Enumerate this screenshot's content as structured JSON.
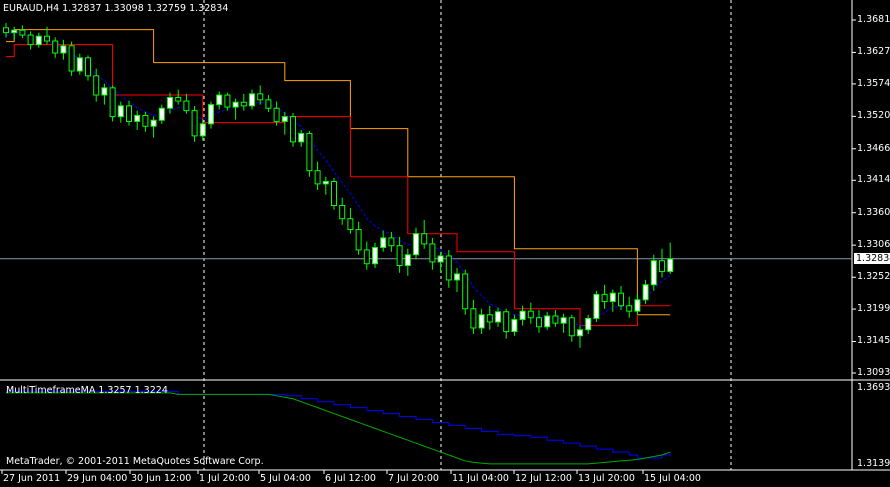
{
  "main_panel": {
    "header": "EURAUD,H4  1.32837 1.33098 1.32759 1.32834",
    "price_levels": [
      "1.36810",
      "1.36270",
      "1.35745",
      "1.35205",
      "1.34665",
      "1.34140",
      "1.33600",
      "1.33060",
      "1.32525",
      "1.31995",
      "1.31455",
      "1.30930"
    ],
    "current_price": "1.32834"
  },
  "indicator_panel": {
    "header": "MultiTimeframeMA 1.3257 1.3224",
    "levels": [
      "1.3693",
      "1.3139"
    ],
    "copyright": "MetaTrader, © 2001-2011 MetaQuotes Software Corp."
  },
  "time_axis": [
    "27 Jun 2011",
    "29 Jun 04:00",
    "30 Jun 12:00",
    "1 Jul 20:00",
    "5 Jul 04:00",
    "6 Jul 12:00",
    "7 Jul 20:00",
    "11 Jul 04:00",
    "12 Jul 12:00",
    "13 Jul 20:00",
    "15 Jul 04:00"
  ],
  "colors": {
    "background": "#000000",
    "bull_candle": "#ffffff",
    "bear_candle": "#000000",
    "wick": "#00ff00",
    "ma_fast": "#ff0000",
    "ma_slow": "#ffa500",
    "ma_dashed": "#0000ff",
    "ind_line_1": "#0000ff",
    "ind_line_2": "#00aa00"
  },
  "chart_data": {
    "type": "candlestick",
    "symbol": "EURAUD",
    "timeframe": "H4",
    "ylim": [
      1.3093,
      1.3681
    ],
    "ohlc": [
      [
        1.3668,
        1.3676,
        1.3652,
        1.366
      ],
      [
        1.366,
        1.367,
        1.3648,
        1.3664
      ],
      [
        1.3664,
        1.3672,
        1.3651,
        1.3656
      ],
      [
        1.3656,
        1.3662,
        1.3632,
        1.364
      ],
      [
        1.364,
        1.366,
        1.3635,
        1.3654
      ],
      [
        1.3654,
        1.367,
        1.364,
        1.3646
      ],
      [
        1.3646,
        1.3652,
        1.3618,
        1.3626
      ],
      [
        1.3626,
        1.3648,
        1.3615,
        1.3638
      ],
      [
        1.3638,
        1.3645,
        1.3588,
        1.3596
      ],
      [
        1.3596,
        1.3625,
        1.359,
        1.3618
      ],
      [
        1.3618,
        1.3622,
        1.358,
        1.3588
      ],
      [
        1.3588,
        1.36,
        1.3545,
        1.3556
      ],
      [
        1.3556,
        1.3575,
        1.354,
        1.3568
      ],
      [
        1.3568,
        1.3572,
        1.3512,
        1.352
      ],
      [
        1.352,
        1.3545,
        1.351,
        1.3538
      ],
      [
        1.3538,
        1.3546,
        1.3505,
        1.3512
      ],
      [
        1.3512,
        1.353,
        1.3498,
        1.3522
      ],
      [
        1.3522,
        1.3528,
        1.3495,
        1.3504
      ],
      [
        1.3504,
        1.352,
        1.3485,
        1.3514
      ],
      [
        1.3514,
        1.354,
        1.3508,
        1.3534
      ],
      [
        1.3534,
        1.356,
        1.3525,
        1.3552
      ],
      [
        1.3552,
        1.3565,
        1.354,
        1.3546
      ],
      [
        1.3546,
        1.3558,
        1.3525,
        1.353
      ],
      [
        1.353,
        1.3538,
        1.3478,
        1.3488
      ],
      [
        1.3488,
        1.3516,
        1.348,
        1.3508
      ],
      [
        1.3508,
        1.3545,
        1.35,
        1.354
      ],
      [
        1.354,
        1.3562,
        1.3532,
        1.3556
      ],
      [
        1.3556,
        1.356,
        1.353,
        1.3536
      ],
      [
        1.3536,
        1.355,
        1.3515,
        1.3544
      ],
      [
        1.3544,
        1.3558,
        1.353,
        1.3538
      ],
      [
        1.3538,
        1.3565,
        1.3532,
        1.3558
      ],
      [
        1.3558,
        1.3572,
        1.354,
        1.3548
      ],
      [
        1.3548,
        1.3556,
        1.3528,
        1.3534
      ],
      [
        1.3534,
        1.3545,
        1.3505,
        1.3512
      ],
      [
        1.3512,
        1.3528,
        1.349,
        1.352
      ],
      [
        1.352,
        1.3526,
        1.347,
        1.3478
      ],
      [
        1.3478,
        1.3498,
        1.347,
        1.3492
      ],
      [
        1.3492,
        1.3496,
        1.342,
        1.343
      ],
      [
        1.343,
        1.3445,
        1.3398,
        1.3408
      ],
      [
        1.3408,
        1.342,
        1.339,
        1.3412
      ],
      [
        1.3412,
        1.3418,
        1.3365,
        1.3372
      ],
      [
        1.3372,
        1.3385,
        1.334,
        1.335
      ],
      [
        1.335,
        1.3368,
        1.3325,
        1.3332
      ],
      [
        1.3332,
        1.3345,
        1.329,
        1.3298
      ],
      [
        1.3298,
        1.3312,
        1.3265,
        1.3275
      ],
      [
        1.3275,
        1.331,
        1.3268,
        1.3302
      ],
      [
        1.3302,
        1.333,
        1.3295,
        1.3318
      ],
      [
        1.3318,
        1.3328,
        1.3295,
        1.3305
      ],
      [
        1.3305,
        1.332,
        1.326,
        1.3272
      ],
      [
        1.3272,
        1.33,
        1.3255,
        1.329
      ],
      [
        1.329,
        1.3335,
        1.3282,
        1.3325
      ],
      [
        1.3325,
        1.3348,
        1.33,
        1.3308
      ],
      [
        1.3308,
        1.3318,
        1.3265,
        1.3278
      ],
      [
        1.3278,
        1.3295,
        1.326,
        1.3288
      ],
      [
        1.3288,
        1.3298,
        1.3235,
        1.3248
      ],
      [
        1.3248,
        1.3268,
        1.3228,
        1.3258
      ],
      [
        1.3258,
        1.3265,
        1.319,
        1.32
      ],
      [
        1.32,
        1.3215,
        1.3158,
        1.3168
      ],
      [
        1.3168,
        1.32,
        1.3158,
        1.319
      ],
      [
        1.319,
        1.3205,
        1.3165,
        1.3178
      ],
      [
        1.3178,
        1.3202,
        1.317,
        1.3195
      ],
      [
        1.3195,
        1.32,
        1.315,
        1.3162
      ],
      [
        1.3162,
        1.319,
        1.3155,
        1.3182
      ],
      [
        1.3182,
        1.3205,
        1.3172,
        1.3196
      ],
      [
        1.3196,
        1.321,
        1.3175,
        1.3185
      ],
      [
        1.3185,
        1.3198,
        1.316,
        1.317
      ],
      [
        1.317,
        1.3195,
        1.3165,
        1.3188
      ],
      [
        1.3188,
        1.3198,
        1.317,
        1.3176
      ],
      [
        1.3176,
        1.3192,
        1.316,
        1.3185
      ],
      [
        1.3185,
        1.319,
        1.3145,
        1.3155
      ],
      [
        1.3155,
        1.3172,
        1.3135,
        1.3165
      ],
      [
        1.3165,
        1.319,
        1.3158,
        1.3184
      ],
      [
        1.3184,
        1.323,
        1.3178,
        1.3224
      ],
      [
        1.3224,
        1.324,
        1.32,
        1.3212
      ],
      [
        1.3212,
        1.3232,
        1.3195,
        1.3226
      ],
      [
        1.3226,
        1.3238,
        1.3198,
        1.3205
      ],
      [
        1.3205,
        1.322,
        1.3185,
        1.3196
      ],
      [
        1.3196,
        1.3225,
        1.319,
        1.3215
      ],
      [
        1.3215,
        1.3248,
        1.3208,
        1.324
      ],
      [
        1.324,
        1.329,
        1.323,
        1.328
      ],
      [
        1.328,
        1.33,
        1.3252,
        1.3262
      ],
      [
        1.3262,
        1.331,
        1.3258,
        1.3283
      ]
    ],
    "ma_fast": [
      1.362,
      1.364,
      1.364,
      1.364,
      1.364,
      1.364,
      1.364,
      1.364,
      1.364,
      1.364,
      1.364,
      1.364,
      1.364,
      1.3556,
      1.3556,
      1.3556,
      1.3556,
      1.3556,
      1.3556,
      1.3556,
      1.3556,
      1.3556,
      1.3556,
      1.3556,
      1.351,
      1.351,
      1.351,
      1.351,
      1.351,
      1.351,
      1.351,
      1.351,
      1.351,
      1.351,
      1.352,
      1.352,
      1.352,
      1.352,
      1.352,
      1.352,
      1.352,
      1.352,
      1.342,
      1.342,
      1.342,
      1.342,
      1.342,
      1.342,
      1.342,
      1.3325,
      1.3325,
      1.3325,
      1.3325,
      1.3325,
      1.3325,
      1.3295,
      1.3295,
      1.3295,
      1.3295,
      1.3295,
      1.3295,
      1.3295,
      1.32,
      1.32,
      1.32,
      1.32,
      1.32,
      1.32,
      1.32,
      1.32,
      1.3172,
      1.3172,
      1.3172,
      1.3172,
      1.3172,
      1.3172,
      1.3172,
      1.3205,
      1.3205,
      1.3205,
      1.3205,
      1.3205
    ],
    "ma_slow": [
      1.3645,
      1.3665,
      1.3665,
      1.3665,
      1.3665,
      1.3665,
      1.3665,
      1.3665,
      1.3665,
      1.3665,
      1.3665,
      1.3665,
      1.3665,
      1.3665,
      1.3665,
      1.3665,
      1.3665,
      1.3665,
      1.361,
      1.361,
      1.361,
      1.361,
      1.361,
      1.361,
      1.361,
      1.361,
      1.361,
      1.361,
      1.361,
      1.361,
      1.361,
      1.361,
      1.361,
      1.361,
      1.358,
      1.358,
      1.358,
      1.358,
      1.358,
      1.358,
      1.358,
      1.358,
      1.35,
      1.35,
      1.35,
      1.35,
      1.35,
      1.35,
      1.35,
      1.342,
      1.342,
      1.342,
      1.342,
      1.342,
      1.342,
      1.342,
      1.342,
      1.342,
      1.342,
      1.342,
      1.342,
      1.342,
      1.33,
      1.33,
      1.33,
      1.33,
      1.33,
      1.33,
      1.33,
      1.33,
      1.33,
      1.33,
      1.33,
      1.33,
      1.33,
      1.33,
      1.33,
      1.319,
      1.319,
      1.319,
      1.319,
      1.319
    ],
    "ma_dashed": [
      1.3655,
      1.366,
      1.3658,
      1.3652,
      1.365,
      1.3648,
      1.364,
      1.3635,
      1.3622,
      1.3618,
      1.3605,
      1.359,
      1.358,
      1.3565,
      1.3555,
      1.3545,
      1.3535,
      1.3528,
      1.3522,
      1.3525,
      1.353,
      1.3535,
      1.3534,
      1.3522,
      1.3516,
      1.352,
      1.3528,
      1.3532,
      1.3536,
      1.3538,
      1.3542,
      1.3544,
      1.3542,
      1.3534,
      1.3526,
      1.3512,
      1.3504,
      1.3484,
      1.3464,
      1.3448,
      1.3428,
      1.341,
      1.3392,
      1.3372,
      1.335,
      1.3338,
      1.333,
      1.3324,
      1.3314,
      1.3306,
      1.331,
      1.3312,
      1.3304,
      1.3298,
      1.3286,
      1.3278,
      1.3258,
      1.3236,
      1.3222,
      1.3208,
      1.3202,
      1.3192,
      1.319,
      1.319,
      1.319,
      1.3186,
      1.3186,
      1.3184,
      1.3184,
      1.3178,
      1.3172,
      1.3174,
      1.3186,
      1.3194,
      1.3202,
      1.3204,
      1.3202,
      1.3206,
      1.3216,
      1.3234,
      1.3246,
      1.3256
    ],
    "indicator": {
      "ylim": [
        1.3139,
        1.3693
      ],
      "line_1": [
        1.365,
        1.365,
        1.365,
        1.365,
        1.365,
        1.365,
        1.365,
        1.365,
        1.365,
        1.365,
        1.365,
        1.365,
        1.365,
        1.365,
        1.365,
        1.365,
        1.365,
        1.365,
        1.365,
        1.365,
        1.365,
        1.363,
        1.363,
        1.363,
        1.363,
        1.363,
        1.363,
        1.363,
        1.363,
        1.363,
        1.363,
        1.363,
        1.363,
        1.363,
        1.362,
        1.362,
        1.36,
        1.36,
        1.358,
        1.358,
        1.356,
        1.356,
        1.354,
        1.354,
        1.352,
        1.352,
        1.35,
        1.35,
        1.348,
        1.348,
        1.346,
        1.346,
        1.344,
        1.344,
        1.342,
        1.342,
        1.34,
        1.34,
        1.338,
        1.338,
        1.336,
        1.336,
        1.335,
        1.335,
        1.334,
        1.334,
        1.332,
        1.332,
        1.33,
        1.33,
        1.328,
        1.328,
        1.326,
        1.326,
        1.324,
        1.324,
        1.322,
        1.32,
        1.32,
        1.32,
        1.322,
        1.324
      ],
      "line_2": [
        1.364,
        1.364,
        1.364,
        1.364,
        1.364,
        1.364,
        1.364,
        1.364,
        1.364,
        1.364,
        1.364,
        1.364,
        1.364,
        1.364,
        1.364,
        1.364,
        1.364,
        1.364,
        1.364,
        1.364,
        1.364,
        1.363,
        1.363,
        1.363,
        1.363,
        1.363,
        1.363,
        1.363,
        1.363,
        1.363,
        1.363,
        1.363,
        1.363,
        1.362,
        1.361,
        1.36,
        1.358,
        1.356,
        1.354,
        1.352,
        1.35,
        1.348,
        1.346,
        1.344,
        1.342,
        1.34,
        1.338,
        1.336,
        1.334,
        1.332,
        1.33,
        1.328,
        1.326,
        1.324,
        1.322,
        1.32,
        1.318,
        1.317,
        1.3165,
        1.316,
        1.316,
        1.316,
        1.316,
        1.316,
        1.316,
        1.316,
        1.316,
        1.316,
        1.316,
        1.316,
        1.316,
        1.316,
        1.3165,
        1.317,
        1.3175,
        1.318,
        1.3185,
        1.319,
        1.32,
        1.321,
        1.322,
        1.324
      ]
    }
  }
}
